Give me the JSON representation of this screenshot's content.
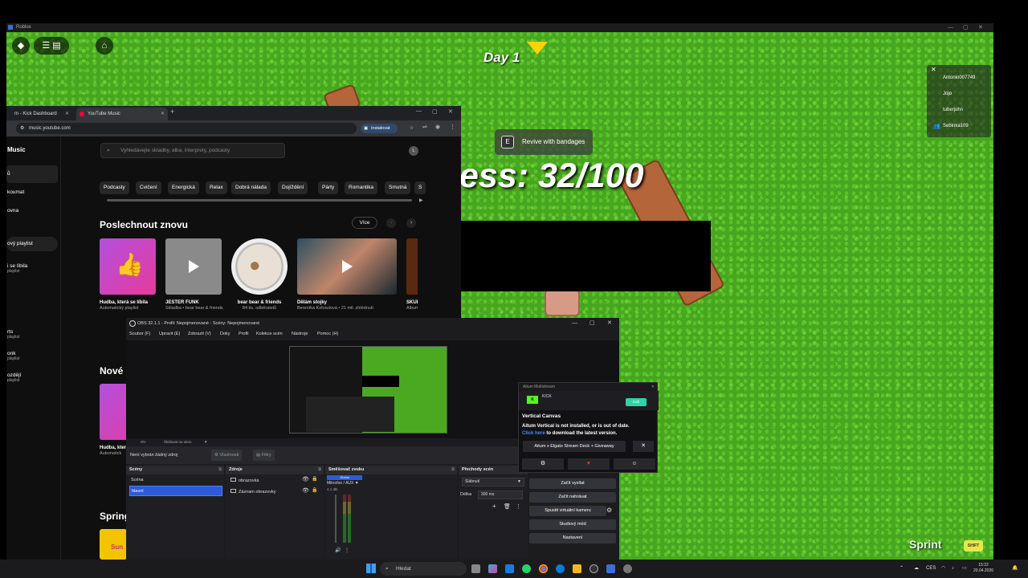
{
  "roblox": {
    "window_title": "Roblox",
    "day_label": "Day 1",
    "revive": {
      "key": "E",
      "label": "Revive with bandages"
    },
    "progress_text": "ess: 32/100",
    "players": [
      "Antonio007749",
      "Jojo",
      "tuberjohn",
      "Sebinka109"
    ],
    "sprint_label": "Sprint",
    "shift_label": "SHIFT"
  },
  "browser": {
    "tabs": [
      {
        "label": "m - Kick Dashboard"
      },
      {
        "label": "YouTube Music"
      }
    ],
    "url": "music.youtube.com",
    "install_label": "Instalovat"
  },
  "ytmusic": {
    "logo_text": "Music",
    "search_placeholder": "Vyhledávejte skladby, alba, interprety, podcasty",
    "avatar_letter": "L",
    "sidebar": [
      {
        "label": "ů",
        "sub": ""
      },
      {
        "label": "koumat",
        "sub": ""
      },
      {
        "label": "ovna",
        "sub": ""
      },
      {
        "label": "ový playlist",
        "sub": ""
      },
      {
        "label": "i se líbila",
        "sub": "playlist"
      },
      {
        "label": "rts",
        "sub": "playlist"
      },
      {
        "label": "onk",
        "sub": "playlist"
      },
      {
        "label": "ozdějí",
        "sub": "playlist"
      }
    ],
    "chips": [
      "Podcasty",
      "Cvičení",
      "Energická",
      "Relax",
      "Dobrá nálada",
      "Dojíždění",
      "Párty",
      "Romantika",
      "Smutná",
      "S"
    ],
    "section_title": "Poslechnout znovu",
    "more_label": "Více",
    "cards": [
      {
        "title": "Hudba, která se líbila",
        "subtitle": "Automatický playlist"
      },
      {
        "title": "JESTER FUNK",
        "subtitle": "Skladba • bear bear & friends"
      },
      {
        "title": "bear bear & friends",
        "subtitle": "84 tis. odběratelů"
      },
      {
        "title": "Dělám stojky",
        "subtitle": "Bereníka Kohoutová • 21 mil. zhlédnutí"
      },
      {
        "title": "SKUL",
        "subtitle": "Album • EVO"
      }
    ],
    "section2_title": "Nové",
    "card2": {
      "title": "Hudba, která",
      "subtitle": "Automatick"
    },
    "section3_title": "Spring",
    "card3_text": "Sun"
  },
  "obs": {
    "title": "OBS 32.1.1 - Profil: Nepojmenované - Scény: Nepojmenované",
    "menu": [
      "Soubor (F)",
      "Upravit (E)",
      "Zobrazit (V)",
      "Doky",
      "Profil",
      "Kolekce scén",
      "Nástroje",
      "Pomoc (H)"
    ],
    "status_zoom": "0%",
    "status_fit": "Škálovat na okno",
    "no_source": "Není vybrán žádný zdroj",
    "properties_label": "Vlastnosti",
    "filters_label": "Filtry",
    "docks": {
      "scenes": "Scény",
      "sources": "Zdroje",
      "mixer": "Směšovač zvuku",
      "transitions": "Přechody scén"
    },
    "scenes": [
      "Scéna",
      "hlavní"
    ],
    "sources": [
      "obrazovka",
      "Záznam obrazovky"
    ],
    "mixer": {
      "tag": "Global",
      "device": "Mikrofon / AUX",
      "level": "4.1 dB"
    },
    "transition": {
      "type": "Slábnutí",
      "duration_label": "Délka",
      "duration": "300 ms"
    },
    "controls": [
      "Začít vysílat",
      "Začít nahrávat",
      "Spustit virtuální kameru",
      "Studiový mód",
      "Nastavení"
    ]
  },
  "aitum": {
    "title": "Aitum Multistream",
    "platform": "KICK",
    "platform_button": "Edit",
    "vc_title": "Vertical Canvas",
    "warning_line1": "Aitum Vertical is not installed, or is out of date.",
    "warning_link": "Click here",
    "warning_line2": " to download the latest version.",
    "giveaway": "Aitum x Elgato Stream Deck + Giveaway"
  },
  "taskbar": {
    "search_label": "Hledat",
    "lang": "CES",
    "time": "15:22",
    "date": "20.04.2026"
  },
  "colors": {
    "obs_selection": "#2d5bd6",
    "kick_green": "#53fc18",
    "grass": "#47a61f"
  }
}
